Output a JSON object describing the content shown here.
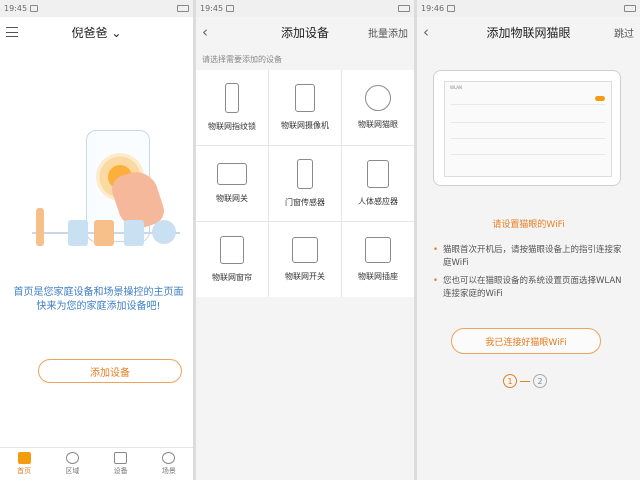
{
  "screen1": {
    "status": {
      "time": "19:45"
    },
    "header": {
      "title": "倪爸爸"
    },
    "message": "首页是您家庭设备和场景操控的主页面\n快来为您的家庭添加设备吧!",
    "add_button": "添加设备",
    "tabs": [
      {
        "label": "首页",
        "active": true
      },
      {
        "label": "区域"
      },
      {
        "label": "设备"
      },
      {
        "label": "场景"
      }
    ]
  },
  "screen2": {
    "status": {
      "time": "19:45"
    },
    "header": {
      "title": "添加设备",
      "right": "批量添加"
    },
    "hint": "请选择需要添加的设备",
    "devices": [
      {
        "label": "物联网指纹锁",
        "icon": "fingerprint-lock-icon"
      },
      {
        "label": "物联网摄像机",
        "icon": "camera-icon"
      },
      {
        "label": "物联网猫眼",
        "icon": "peephole-icon"
      },
      {
        "label": "物联网关",
        "icon": "gateway-icon"
      },
      {
        "label": "门窗传感器",
        "icon": "door-sensor-icon"
      },
      {
        "label": "人体感应器",
        "icon": "motion-sensor-icon"
      },
      {
        "label": "物联网窗帘",
        "icon": "curtain-icon"
      },
      {
        "label": "物联网开关",
        "icon": "switch-icon"
      },
      {
        "label": "物联网插座",
        "icon": "socket-icon"
      }
    ]
  },
  "screen3": {
    "status": {
      "time": "19:46"
    },
    "header": {
      "title": "添加物联网猫眼",
      "right": "跳过"
    },
    "wlan_label": "WLAN",
    "set_title": "请设置猫眼的WiFi",
    "bullets": [
      "猫眼首次开机后，请按猫眼设备上的指引连接家庭WiFi",
      "您也可以在猫眼设备的系统设置页面选择WLAN连接家庭的WiFi"
    ],
    "connect_button": "我已连接好猫眼WiFi",
    "steps": [
      "1",
      "2"
    ]
  },
  "colors": {
    "accent": "#e67e22",
    "link": "#3d7fc6"
  }
}
